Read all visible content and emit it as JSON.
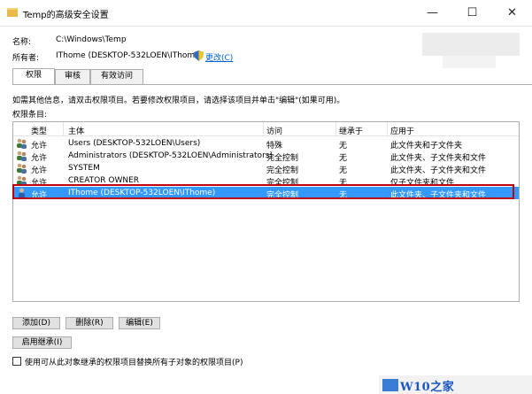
{
  "window": {
    "title": "Temp的高级安全设置",
    "minimize_glyph": "—",
    "maximize_glyph": "☐",
    "close_glyph": "✕"
  },
  "header": {
    "name_label": "名称:",
    "name_value": "C:\\Windows\\Temp",
    "owner_label": "所有者:",
    "owner_value": "IThome (DESKTOP-532LOEN\\IThome)",
    "change_link": "更改(C)"
  },
  "tabs": [
    {
      "label": "权限",
      "active": true
    },
    {
      "label": "审核",
      "active": false
    },
    {
      "label": "有效访问",
      "active": false
    }
  ],
  "info_text": "如需其他信息，请双击权限项目。若要修改权限项目，请选择该项目并单击\"编辑\"(如果可用)。",
  "entries_label": "权限条目:",
  "table": {
    "columns": [
      "类型",
      "主体",
      "访问",
      "继承于",
      "应用于"
    ],
    "rows": [
      {
        "type": "允许",
        "principal": "Users (DESKTOP-532LOEN\\Users)",
        "access": "特殊",
        "inherited": "无",
        "applies": "此文件夹和子文件夹",
        "selected": false
      },
      {
        "type": "允许",
        "principal": "Administrators (DESKTOP-532LOEN\\Administrators)",
        "access": "完全控制",
        "inherited": "无",
        "applies": "此文件夹、子文件夹和文件",
        "selected": false
      },
      {
        "type": "允许",
        "principal": "SYSTEM",
        "access": "完全控制",
        "inherited": "无",
        "applies": "此文件夹、子文件夹和文件",
        "selected": false
      },
      {
        "type": "允许",
        "principal": "CREATOR OWNER",
        "access": "完全控制",
        "inherited": "无",
        "applies": "仅子文件夹和文件",
        "selected": false
      },
      {
        "type": "允许",
        "principal": "IThome (DESKTOP-532LOEN\\IThome)",
        "access": "完全控制",
        "inherited": "无",
        "applies": "此文件夹、子文件夹和文件",
        "selected": true
      }
    ]
  },
  "buttons": {
    "add": "添加(D)",
    "remove": "删除(R)",
    "edit": "编辑(E)",
    "enable_inheritance": "启用继承(I)"
  },
  "replace_checkbox_label": "使用可从此对象继承的权限项目替换所有子对象的权限项目(P)",
  "watermark": "W10之家 W10Z.COM",
  "colors": {
    "selection": "#3399ff",
    "highlight_border": "#c00010",
    "link": "#0066cc"
  }
}
